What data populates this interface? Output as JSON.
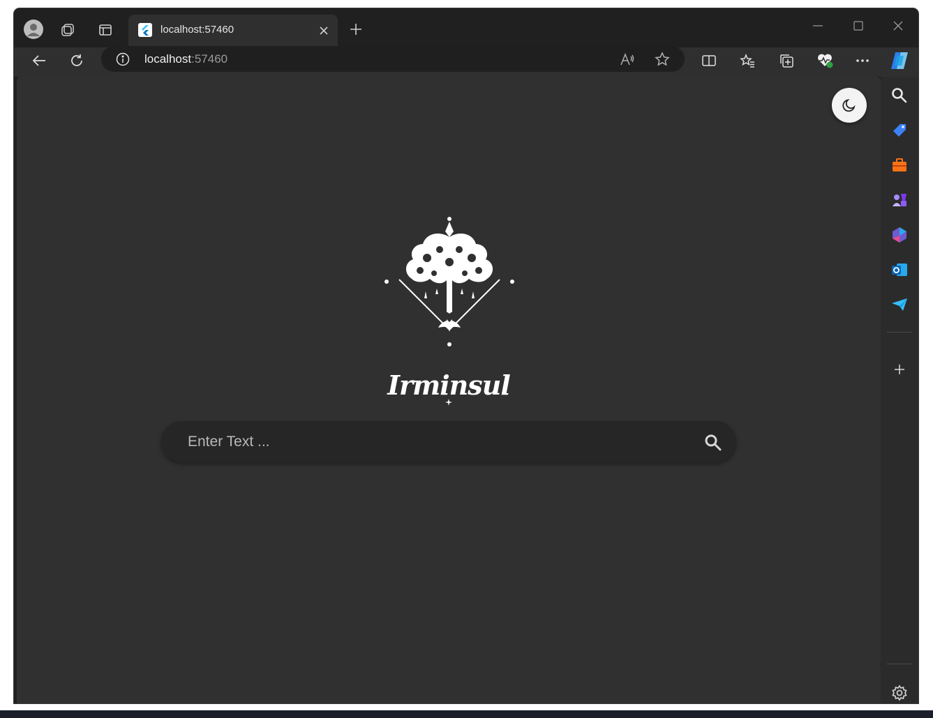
{
  "browser": {
    "tab": {
      "title": "localhost:57460"
    },
    "address": {
      "host": "localhost",
      "port": ":57460"
    }
  },
  "page": {
    "brand_name": "Irminsul",
    "search": {
      "placeholder": "Enter Text ..."
    }
  },
  "icons": {
    "tabbar": [
      "profile-icon",
      "workspaces-icon",
      "vertical-tabs-icon",
      "flutter-favicon",
      "close-tab-icon",
      "new-tab-icon",
      "minimize-icon",
      "maximize-icon",
      "close-window-icon"
    ],
    "toolbar": [
      "back-icon",
      "refresh-icon",
      "info-icon",
      "read-aloud-icon",
      "favorite-star-icon",
      "split-screen-icon",
      "favorites-icon",
      "collections-icon",
      "browser-essentials-icon",
      "more-icon",
      "copilot-icon"
    ],
    "sidebar": [
      "search-icon",
      "shopping-icon",
      "tools-icon",
      "games-icon",
      "microsoft-365-icon",
      "outlook-icon",
      "drop-icon",
      "add-icon",
      "settings-icon"
    ],
    "page": [
      "theme-toggle-moon-icon",
      "irminsul-tree-logo",
      "search-icon"
    ]
  },
  "colors": {
    "window_bg": "#202020",
    "page_bg": "#303030",
    "search_bg": "#262626",
    "sidebar_bg": "#2b2b2b"
  }
}
